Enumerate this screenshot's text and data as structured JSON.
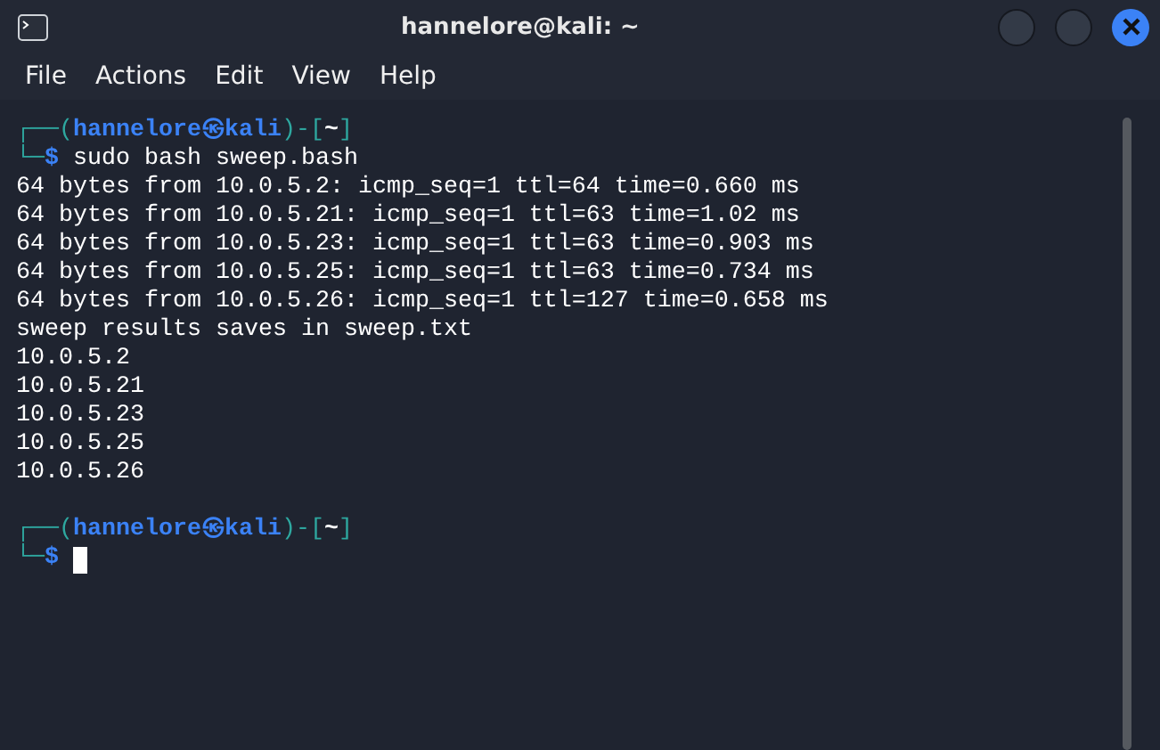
{
  "window": {
    "title": "hannelore@kali: ~"
  },
  "menu": [
    "File",
    "Actions",
    "Edit",
    "View",
    "Help"
  ],
  "terminal": {
    "blocks": [
      {
        "kind": "prompt",
        "frame_top": "┌──(",
        "user": "hannelore",
        "symbol": "㉿",
        "host": "kali",
        "mid": ")-[",
        "dir": "~",
        "end": "]",
        "frame_bottom": "└─",
        "sign": "$",
        "command": "sudo bash sweep.bash",
        "cursor": false
      },
      {
        "kind": "output",
        "lines": [
          "64 bytes from 10.0.5.2: icmp_seq=1 ttl=64 time=0.660 ms",
          "64 bytes from 10.0.5.21: icmp_seq=1 ttl=63 time=1.02 ms",
          "64 bytes from 10.0.5.23: icmp_seq=1 ttl=63 time=0.903 ms",
          "64 bytes from 10.0.5.25: icmp_seq=1 ttl=63 time=0.734 ms",
          "64 bytes from 10.0.5.26: icmp_seq=1 ttl=127 time=0.658 ms",
          "sweep results saves in sweep.txt",
          "10.0.5.2",
          "10.0.5.21",
          "10.0.5.23",
          "10.0.5.25",
          "10.0.5.26"
        ]
      },
      {
        "kind": "prompt",
        "frame_top": "┌──(",
        "user": "hannelore",
        "symbol": "㉿",
        "host": "kali",
        "mid": ")-[",
        "dir": "~",
        "end": "]",
        "frame_bottom": "└─",
        "sign": "$",
        "cursor": true
      }
    ]
  }
}
